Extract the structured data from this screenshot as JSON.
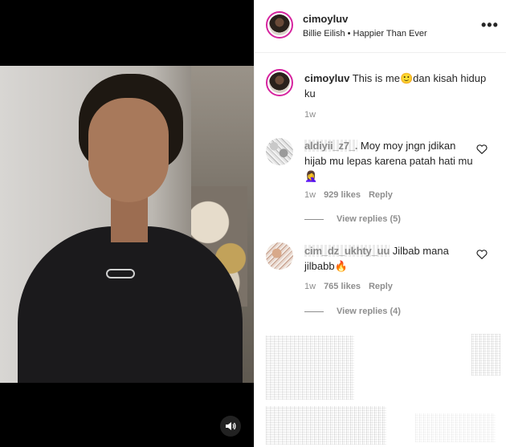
{
  "post": {
    "username": "cimoyluv",
    "song": "Billie Eilish • Happier Than Ever"
  },
  "caption": {
    "username": "cimoyluv",
    "text": " This is me🙂dan kisah hidup ku",
    "time": "1w"
  },
  "comments": [
    {
      "username": "aldiyii_z7_.",
      "text": " Moy moy jngn jdikan hijab mu lepas karena patah hati mu 🤦‍♀️",
      "time": "1w",
      "likes": "929 likes",
      "reply": "Reply",
      "view_replies": "View replies (5)"
    },
    {
      "username": "cim_dz_ukhty_uu",
      "text": " Jilbab mana jilbabb🔥",
      "time": "1w",
      "likes": "765 likes",
      "reply": "Reply",
      "view_replies": "View replies (4)"
    }
  ],
  "icons": {
    "more": "more-options-icon",
    "heart": "heart-icon",
    "sound": "speaker-icon"
  },
  "colors": {
    "text": "#262626",
    "muted": "#8e8e8e",
    "story_ring": "#d6249f"
  }
}
